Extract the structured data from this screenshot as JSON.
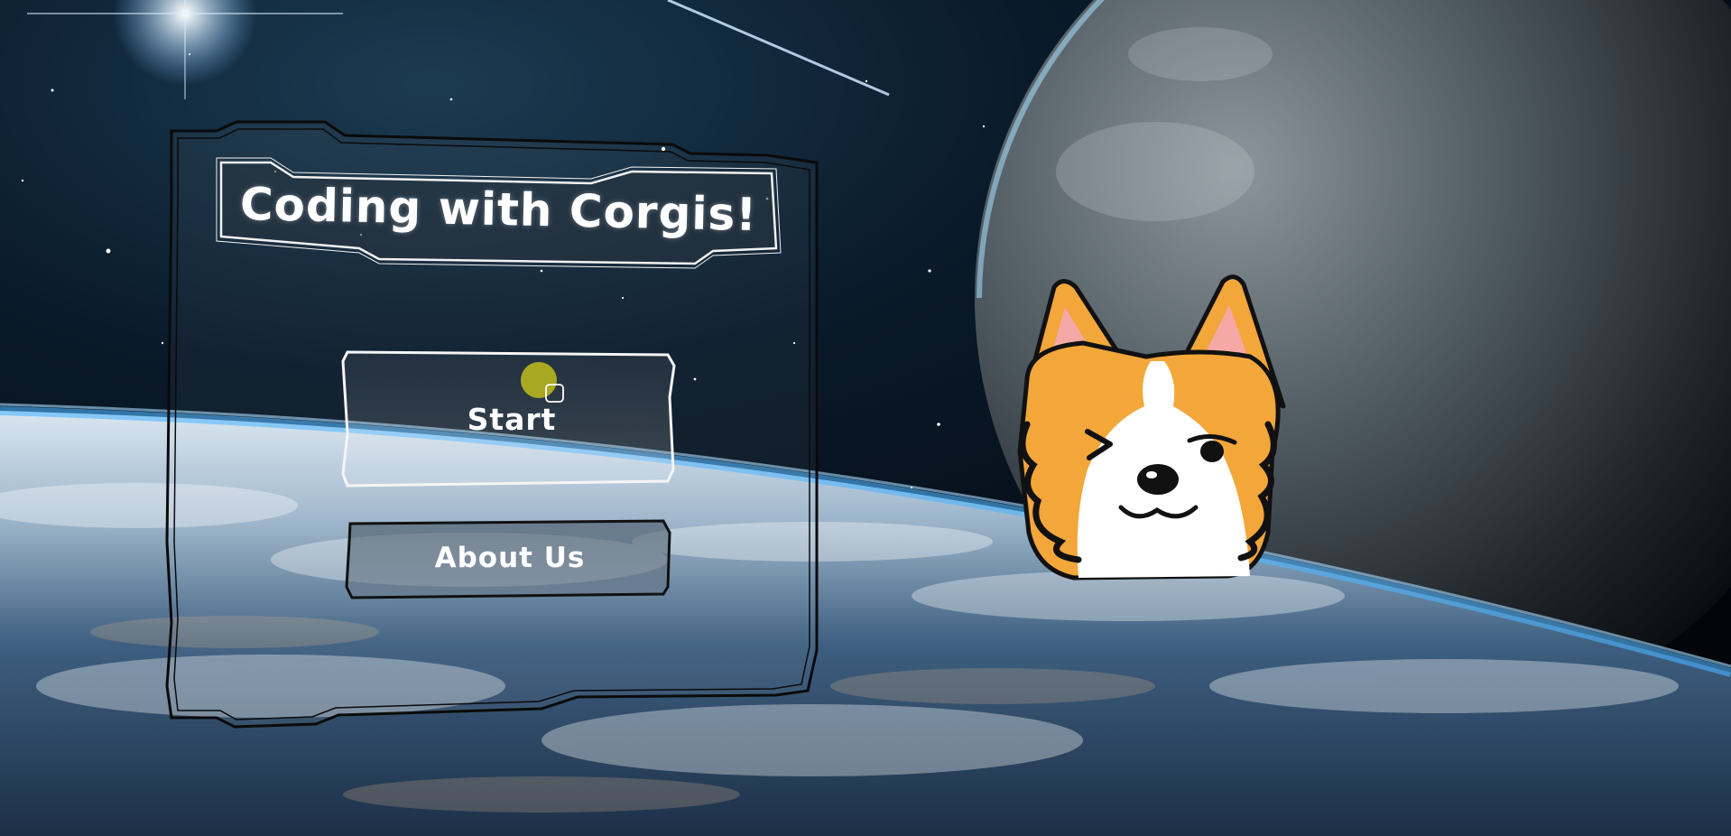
{
  "menu": {
    "title": "Coding with Corgis!",
    "start_label": "Start",
    "about_label": "About Us"
  },
  "mascot": {
    "name": "corgi-mascot",
    "expression": "winking"
  },
  "colors": {
    "panel_border": "#0a0a0a",
    "title_plate_border": "#f2f2f2",
    "start_button_border": "#f5f5f5",
    "about_button_border": "#111111",
    "cursor_dot": "#b8b51f",
    "corgi_orange": "#f3a63a",
    "corgi_white": "#ffffff",
    "space_dark": "#02060c",
    "atmosphere_blue": "#2f8fd8"
  }
}
